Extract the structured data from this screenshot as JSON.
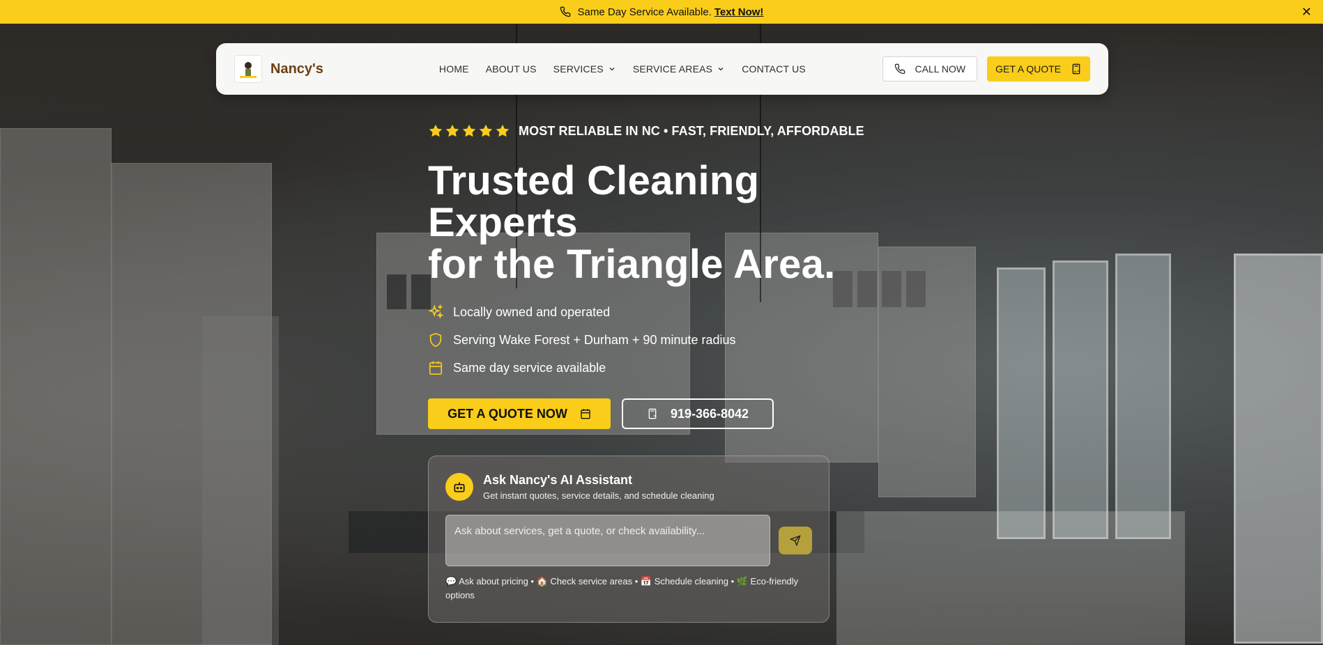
{
  "announcement": {
    "text": "Same Day Service Available.",
    "link": "Text Now!",
    "close": "✕"
  },
  "nav": {
    "brand": "Nancy's",
    "items": [
      {
        "label": "HOME"
      },
      {
        "label": "ABOUT US"
      },
      {
        "label": "SERVICES"
      },
      {
        "label": "SERVICE AREAS"
      },
      {
        "label": "CONTACT US"
      }
    ],
    "call_label": "CALL NOW",
    "quote_label": "GET A QUOTE"
  },
  "hero": {
    "rating_text": "MOST RELIABLE IN NC • FAST, FRIENDLY, AFFORDABLE",
    "star_count": 5,
    "headline_line1": "Trusted Cleaning",
    "headline_line2": "Experts",
    "headline_line3": "for the Triangle Area.",
    "features": [
      {
        "icon": "sparkles-icon",
        "text": "Locally owned and operated"
      },
      {
        "icon": "shield-icon",
        "text": "Serving Wake Forest + Durham + 90 minute radius"
      },
      {
        "icon": "calendar-icon",
        "text": "Same day service available"
      }
    ],
    "quote_button": "GET A QUOTE NOW",
    "phone_button": "919-366-8042"
  },
  "assistant": {
    "title": "Ask Nancy's AI Assistant",
    "subtitle": "Get instant quotes, service details, and schedule cleaning",
    "placeholder": "Ask about services, get a quote, or check availability...",
    "hints": "💬 Ask about pricing • 🏠 Check service areas • 📅 Schedule cleaning • 🌿 Eco-friendly options"
  },
  "colors": {
    "accent": "#f9cd19",
    "brand_text": "#6b3f12"
  }
}
